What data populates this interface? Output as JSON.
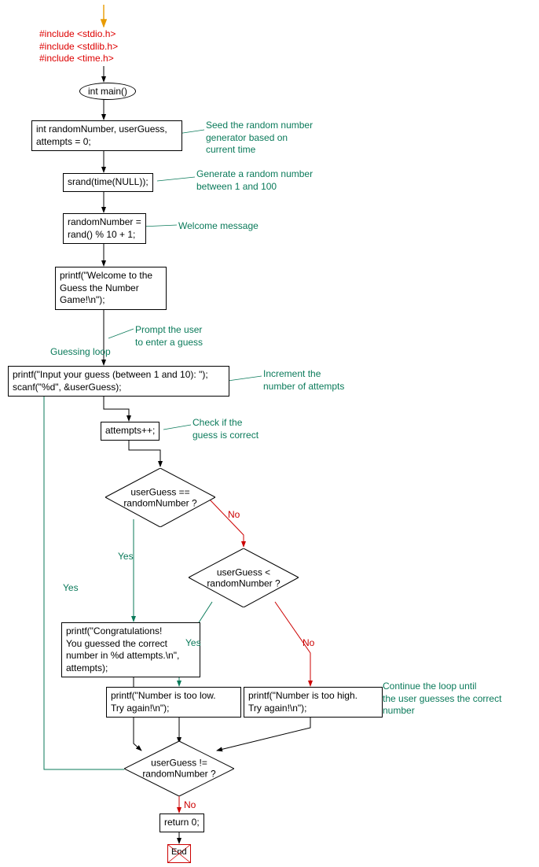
{
  "chart_data": {
    "type": "flowchart",
    "language": "C",
    "nodes": [
      {
        "id": "start_arrow",
        "type": "start"
      },
      {
        "id": "includes",
        "type": "code",
        "text": "#include <stdio.h>\n#include <stdlib.h>\n#include <time.h>"
      },
      {
        "id": "main",
        "type": "terminal",
        "text": "int main()"
      },
      {
        "id": "decl",
        "type": "process",
        "text": "int randomNumber, userGuess,\nattempts = 0;"
      },
      {
        "id": "srand",
        "type": "process",
        "text": "srand(time(NULL));"
      },
      {
        "id": "rand",
        "type": "process",
        "text": "randomNumber =\nrand() % 10 + 1;"
      },
      {
        "id": "welcome",
        "type": "process",
        "text": "printf(\"Welcome to the\nGuess the Number\nGame!\\n\");"
      },
      {
        "id": "prompt",
        "type": "process",
        "text": "printf(\"Input your guess (between 1 and 10): \");\nscanf(\"%d\", &userGuess);"
      },
      {
        "id": "inc",
        "type": "process",
        "text": "attempts++;"
      },
      {
        "id": "eq",
        "type": "decision",
        "text": "userGuess ==\nrandomNumber ?"
      },
      {
        "id": "lt",
        "type": "decision",
        "text": "userGuess <\nrandomNumber ?"
      },
      {
        "id": "congrats",
        "type": "process",
        "text": "printf(\"Congratulations!\nYou guessed the correct\nnumber in %d attempts.\\n\",\nattempts);"
      },
      {
        "id": "low",
        "type": "process",
        "text": "printf(\"Number is too low.\nTry again!\\n\");"
      },
      {
        "id": "high",
        "type": "process",
        "text": "printf(\"Number is too high.\nTry again!\\n\");"
      },
      {
        "id": "loopcond",
        "type": "decision",
        "text": "userGuess !=\nrandomNumber ?"
      },
      {
        "id": "return",
        "type": "process",
        "text": "return 0;"
      },
      {
        "id": "end",
        "type": "terminal",
        "text": "End"
      }
    ],
    "edges": [
      {
        "from": "start_arrow",
        "to": "includes"
      },
      {
        "from": "includes",
        "to": "main"
      },
      {
        "from": "main",
        "to": "decl"
      },
      {
        "from": "decl",
        "to": "srand"
      },
      {
        "from": "srand",
        "to": "rand"
      },
      {
        "from": "rand",
        "to": "welcome"
      },
      {
        "from": "welcome",
        "to": "prompt"
      },
      {
        "from": "prompt",
        "to": "inc"
      },
      {
        "from": "inc",
        "to": "eq"
      },
      {
        "from": "eq",
        "to": "congrats",
        "label": "Yes"
      },
      {
        "from": "eq",
        "to": "lt",
        "label": "No"
      },
      {
        "from": "lt",
        "to": "low",
        "label": "Yes"
      },
      {
        "from": "lt",
        "to": "high",
        "label": "No"
      },
      {
        "from": "congrats",
        "to": "loopcond"
      },
      {
        "from": "low",
        "to": "loopcond"
      },
      {
        "from": "high",
        "to": "loopcond"
      },
      {
        "from": "loopcond",
        "to": "prompt",
        "label": "Yes"
      },
      {
        "from": "loopcond",
        "to": "return",
        "label": "No"
      },
      {
        "from": "return",
        "to": "end"
      }
    ],
    "comments": [
      {
        "target": "decl",
        "text": "Seed the random number\ngenerator based on\ncurrent time"
      },
      {
        "target": "srand",
        "text": "Generate a random number\nbetween 1 and 100"
      },
      {
        "target": "rand",
        "text": "Welcome message"
      },
      {
        "target": "welcome",
        "text": "Guessing loop"
      },
      {
        "target": "prompt_pre",
        "text": "Prompt the user\nto enter a guess"
      },
      {
        "target": "prompt",
        "text": "Increment the\nnumber of attempts"
      },
      {
        "target": "inc",
        "text": "Check if the\nguess is correct"
      },
      {
        "target": "high",
        "text": "Continue the loop until\nthe user guesses the correct\nnumber"
      }
    ]
  },
  "labels": {
    "includes_line1": "#include <stdio.h>",
    "includes_line2": "#include <stdlib.h>",
    "includes_line3": "#include <time.h>",
    "main": "int main()",
    "decl": "int randomNumber, userGuess,",
    "decl2": "attempts = 0;",
    "srand": "srand(time(NULL));",
    "rand1": "randomNumber =",
    "rand2": "rand() % 10 + 1;",
    "welcome1": "printf(\"Welcome to the",
    "welcome2": "Guess the Number",
    "welcome3": "Game!\\n\");",
    "prompt1": "printf(\"Input your guess (between 1 and 10): \");",
    "prompt2": "scanf(\"%d\", &userGuess);",
    "inc": "attempts++;",
    "eq1": "userGuess ==",
    "eq2": "randomNumber ?",
    "lt1": "userGuess <",
    "lt2": "randomNumber ?",
    "congrats1": "printf(\"Congratulations!",
    "congrats2": "You guessed the correct",
    "congrats3": "number in %d attempts.\\n\",",
    "congrats4": "attempts);",
    "low1": "printf(\"Number is too low.",
    "low2": "Try again!\\n\");",
    "high1": "printf(\"Number is too high.",
    "high2": "Try again!\\n\");",
    "loop1": "userGuess !=",
    "loop2": "randomNumber ?",
    "return": "return 0;",
    "end": "End",
    "yes": "Yes",
    "no": "No",
    "comment_seed": "Seed the random number",
    "comment_seed2": "generator based on",
    "comment_seed3": "current time",
    "comment_gen": "Generate a random number",
    "comment_gen2": "between 1 and 100",
    "comment_welcome": "Welcome message",
    "comment_guessloop": "Guessing loop",
    "comment_prompt1": "Prompt the user",
    "comment_prompt2": "to enter a guess",
    "comment_incr1": "Increment the",
    "comment_incr2": "number of attempts",
    "comment_check1": "Check if the",
    "comment_check2": "guess is correct",
    "comment_loop1": "Continue the loop until",
    "comment_loop2": "the user guesses the correct",
    "comment_loop3": "number"
  }
}
